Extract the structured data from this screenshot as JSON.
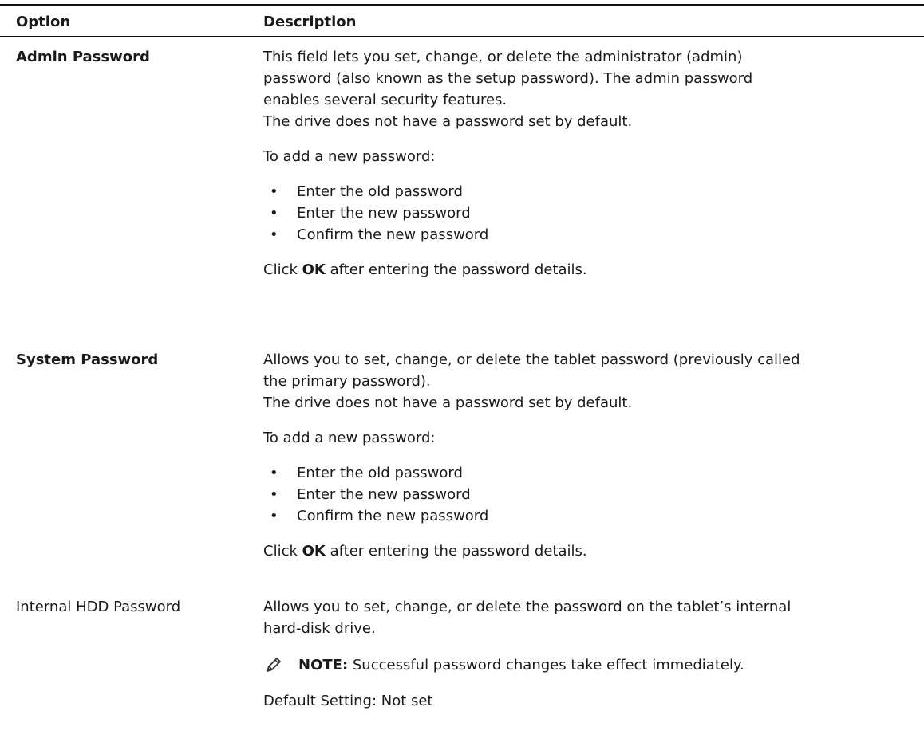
{
  "header": {
    "option": "Option",
    "description": "Description"
  },
  "rows": [
    {
      "option": "Admin Password",
      "intro": "This field lets you set, change, or delete the administrator (admin) password (also known as the setup password). The admin password enables several security features.",
      "intro_line1": "This field lets you set, change, or delete the administrator (admin)",
      "intro_line2": "password (also known as the setup password). The admin password",
      "intro_line3": "enables several security features.",
      "default_note": "The drive does not have a password set by default.",
      "add_heading": "To add a new password:",
      "steps": [
        "Enter the old password",
        "Enter the new password",
        "Confirm the new password"
      ],
      "click_pre": "Click",
      "click_ok": "OK",
      "click_post": "after entering the password details."
    },
    {
      "option": "System Password",
      "intro_line1": "Allows you to set, change, or delete the tablet password (previously called",
      "intro_line2": "the primary password).",
      "default_note": "The drive does not have a password set by default.",
      "add_heading": "To add a new password:",
      "steps": [
        "Enter the old password",
        "Enter the new password",
        "Confirm the new password"
      ],
      "click_pre": "Click",
      "click_ok": "OK",
      "click_post": "after entering the password details."
    },
    {
      "option": "Internal HDD Password",
      "intro_line1": "Allows you to set, change, or delete the password on the tablet’s internal",
      "intro_line2": "hard-disk drive.",
      "note_label": "NOTE:",
      "note_text": "Successful password changes take effect immediately.",
      "default_setting": "Default Setting: Not set"
    }
  ],
  "bullet_glyph": "•",
  "icons": {
    "note": "pencil-note-icon"
  }
}
